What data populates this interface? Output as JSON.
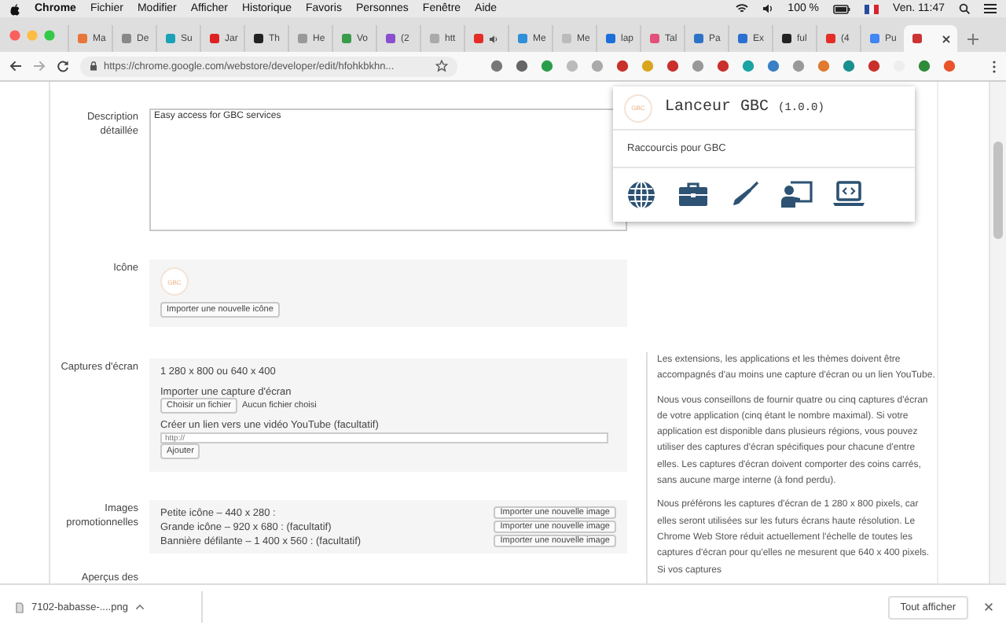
{
  "menubar": {
    "app": "Chrome",
    "menus": [
      "Fichier",
      "Modifier",
      "Afficher",
      "Historique",
      "Favoris",
      "Personnes",
      "Fenêtre",
      "Aide"
    ],
    "battery": "100 %",
    "clock": "Ven. 11:47"
  },
  "tabs": [
    {
      "label": "Ma",
      "audio": false,
      "selected": false
    },
    {
      "label": "De",
      "audio": false,
      "selected": false
    },
    {
      "label": "Su",
      "audio": false,
      "selected": false
    },
    {
      "label": "Jar",
      "audio": false,
      "selected": false
    },
    {
      "label": "Th",
      "audio": false,
      "selected": false
    },
    {
      "label": "He",
      "audio": false,
      "selected": false
    },
    {
      "label": "Vo",
      "audio": false,
      "selected": false
    },
    {
      "label": "(2",
      "audio": false,
      "selected": false
    },
    {
      "label": "htt",
      "audio": false,
      "selected": false
    },
    {
      "audio": true,
      "selected": false
    },
    {
      "label": "Me",
      "audio": false,
      "selected": false
    },
    {
      "label": "Me",
      "audio": false,
      "selected": false
    },
    {
      "label": "lap",
      "audio": false,
      "selected": false
    },
    {
      "label": "Tal",
      "audio": false,
      "selected": false
    },
    {
      "label": "Pa",
      "audio": false,
      "selected": false
    },
    {
      "label": "Ex",
      "audio": false,
      "selected": false
    },
    {
      "label": "ful",
      "audio": false,
      "selected": false
    },
    {
      "label": "(4",
      "audio": false,
      "selected": false
    },
    {
      "label": "Pu",
      "audio": false,
      "selected": false
    },
    {
      "audio": false,
      "selected": true
    }
  ],
  "address": {
    "url": "https://chrome.google.com/webstore/developer/edit/hfohkbkhn..."
  },
  "form": {
    "description": {
      "label": "Description détaillée",
      "value": "Easy access for GBC services"
    },
    "icon": {
      "label": "Icône",
      "logo": "GBC",
      "button": "Importer une nouvelle icône"
    },
    "screenshots": {
      "label": "Captures d'écran",
      "sizes": "1 280 x 800 ou 640 x 400",
      "upload_title": "Importer une capture d'écran",
      "file_button": "Choisir un fichier",
      "file_status": "Aucun fichier choisi",
      "video_title": "Créer un lien vers une vidéo YouTube (facultatif)",
      "video_placeholder": "http://",
      "add_button": "Ajouter"
    },
    "promo": {
      "label": "Images promotionnelles",
      "rows": [
        {
          "text": "Petite icône – 440 x 280 :",
          "button": "Importer une nouvelle image"
        },
        {
          "text": "Grande icône – 920 x 680 : (facultatif)",
          "button": "Importer une nouvelle image"
        },
        {
          "text": "Bannière défilante – 1 400 x 560 : (facultatif)",
          "button": "Importer une nouvelle image"
        }
      ]
    },
    "previews_label": "Aperçus des"
  },
  "help": [
    "Les extensions, les applications et les thèmes doivent être accompagnés d'au moins une capture d'écran ou un lien YouTube.",
    "Nous vous conseillons de fournir quatre ou cinq captures d'écran de votre application (cinq étant le nombre maximal). Si votre application est disponible dans plusieurs régions, vous pouvez utiliser des captures d'écran spécifiques pour chacune d'entre elles. Les captures d'écran doivent comporter des coins carrés, sans aucune marge interne (à fond perdu).",
    "Nous préférons les captures d'écran de 1 280 x 800 pixels, car elles seront utilisées sur les futurs écrans haute résolution. Le Chrome Web Store réduit actuellement l'échelle de toutes les captures d'écran pour qu'elles ne mesurent que 640 x 400 pixels. Si vos captures"
  ],
  "popup": {
    "logo": "GBC",
    "title": "Lanceur GBC",
    "version": "(1.0.0)",
    "subtitle": "Raccourcis pour GBC",
    "shortcuts": [
      {
        "kind": "globe"
      },
      {
        "kind": "briefcase"
      },
      {
        "kind": "screwdriver"
      },
      {
        "kind": "presenter"
      },
      {
        "kind": "laptop-code"
      }
    ]
  },
  "downloads": {
    "file": "7102-babasse-....png",
    "show_all": "Tout afficher"
  }
}
